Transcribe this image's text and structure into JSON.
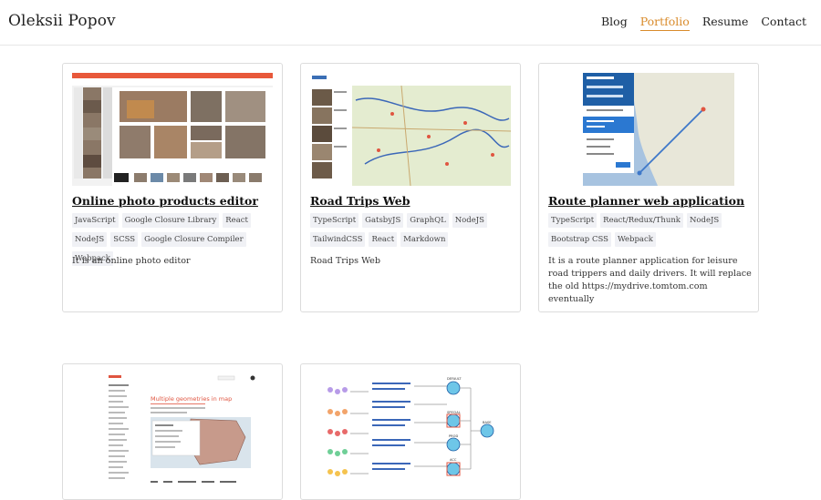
{
  "site": {
    "title": "Oleksii Popov"
  },
  "nav": {
    "items": [
      "Blog",
      "Portfolio",
      "Resume",
      "Contact"
    ],
    "active": "Portfolio"
  },
  "colors": {
    "accent": "#d98b2b",
    "tag_bg": "#f0f1f5"
  },
  "projects": [
    {
      "title": "Online photo products editor",
      "tags": [
        "JavaScript",
        "Google Closure Library",
        "React",
        "NodeJS",
        "SCSS",
        "Google Closure Compiler",
        "Webpack"
      ],
      "description": "It is an online photo editor"
    },
    {
      "title": "Road Trips Web",
      "tags": [
        "TypeScript",
        "GatsbyJS",
        "GraphQL",
        "NodeJS",
        "TailwindCSS",
        "React",
        "Markdown"
      ],
      "description": "Road Trips Web"
    },
    {
      "title": "Route planner web application",
      "tags": [
        "TypeScript",
        "React/Redux/Thunk",
        "NodeJS",
        "Bootstrap CSS",
        "Webpack"
      ],
      "description": "It is a route planner application for leisure road trippers and daily drivers. It will replace the old https://mydrive.tomtom.com eventually"
    },
    {
      "thumb_heading": "Multiple geometries in map"
    },
    {
      "thumb_labels": [
        "DEFAULT",
        "SPECIAL",
        "PROD",
        "ACC",
        "BASE"
      ]
    }
  ]
}
